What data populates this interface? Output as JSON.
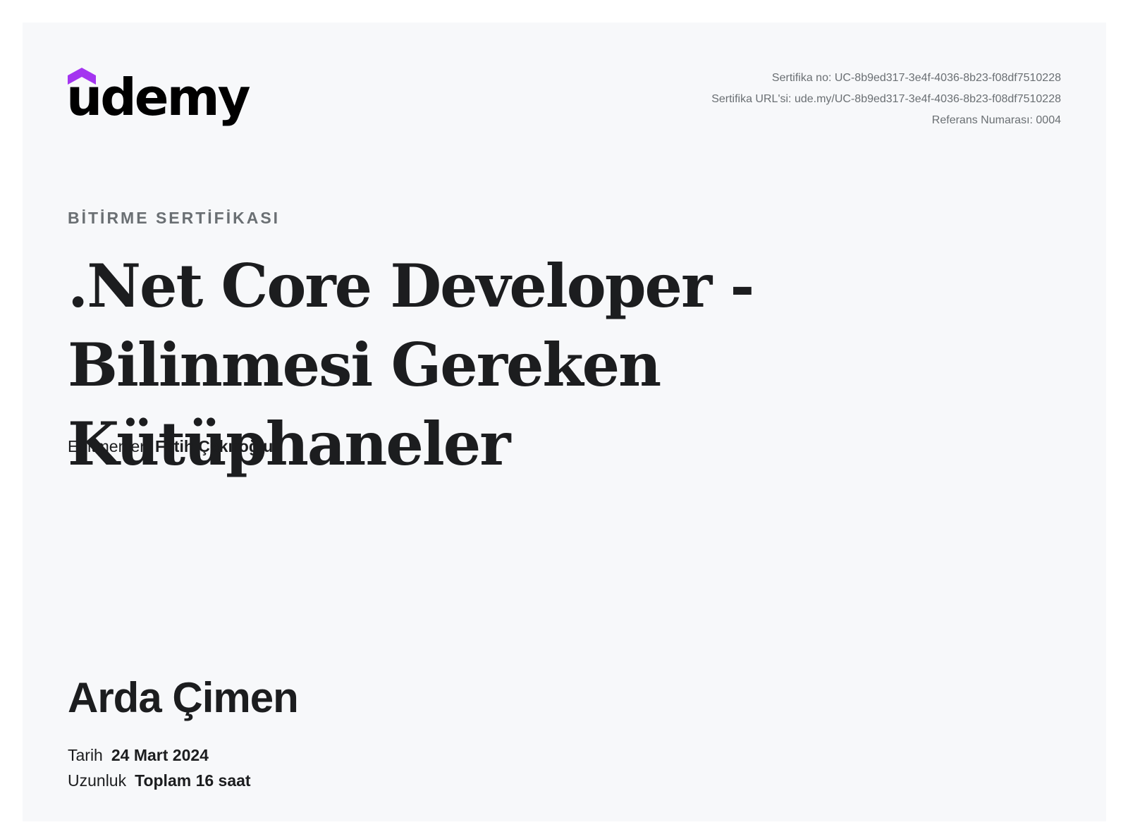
{
  "brand": {
    "name": "udemy",
    "accent_color": "#a435f0"
  },
  "certificate_meta": {
    "number": "Sertifika no: UC-8b9ed317-3e4f-4036-8b23-f08df7510228",
    "url": "Sertifika URL'si: ude.my/UC-8b9ed317-3e4f-4036-8b23-f08df7510228",
    "reference": "Referans Numarası: 0004"
  },
  "kicker": "BİTİRME SERTİFİKASI",
  "course": {
    "title": ".Net Core Developer - Bilinmesi Gereken Kütüphaneler"
  },
  "instructors": {
    "label": "Eğitmenler",
    "names": "Fatih Çakıroğlu"
  },
  "student": {
    "name": "Arda Çimen"
  },
  "details": {
    "date_label": "Tarih",
    "date_value": "24 Mart 2024",
    "duration_label": "Uzunluk",
    "duration_value": "Toplam 16 saat"
  }
}
